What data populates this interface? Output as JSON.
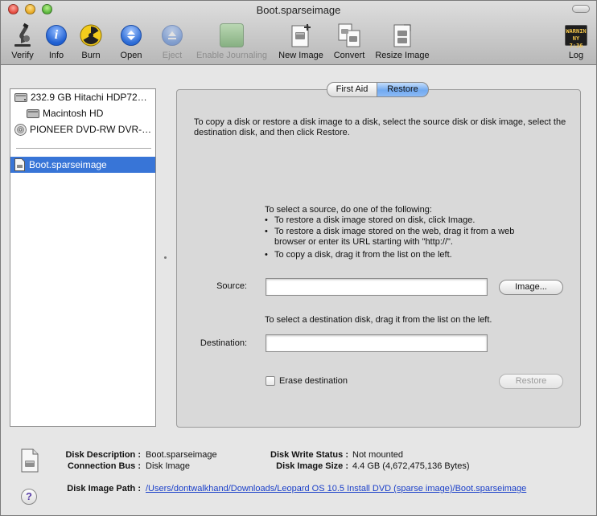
{
  "window": {
    "title": "Boot.sparseimage"
  },
  "toolbar": {
    "verify": "Verify",
    "info": "Info",
    "burn": "Burn",
    "open": "Open",
    "eject": "Eject",
    "enable_journaling": "Enable Journaling",
    "new_image": "New Image",
    "convert": "Convert",
    "resize_image": "Resize Image",
    "log": "Log",
    "log_icon_text_1": "WARNIN",
    "log_icon_text_2": "NY 7:36"
  },
  "sidebar": {
    "items": [
      {
        "label": "232.9 GB Hitachi HDP72…",
        "icon": "hard-drive-icon"
      },
      {
        "label": "Macintosh HD",
        "icon": "volume-icon"
      },
      {
        "label": "PIONEER DVD-RW DVR-…",
        "icon": "optical-drive-icon"
      },
      {
        "label": "Boot.sparseimage",
        "icon": "disk-image-icon",
        "selected": true
      }
    ]
  },
  "tabs": [
    {
      "label": "First Aid",
      "active": false
    },
    {
      "label": "Restore",
      "active": true
    }
  ],
  "restore": {
    "instruction": "To copy a disk or restore a disk image to a disk, select the source disk or disk image, select the destination disk, and then click Restore.",
    "source_heading": "To select a source, do one of the following:",
    "bullets": [
      "To restore a disk image stored on disk, click Image.",
      "To restore a disk image stored on the web, drag it from a web",
      "browser or enter its URL starting with \"http://\".",
      "To copy a disk, drag it from the list on the left."
    ],
    "source_label": "Source:",
    "source_value": "",
    "image_button": "Image...",
    "destination_hint": "To select a destination disk, drag it from the list on the left.",
    "destination_label": "Destination:",
    "destination_value": "",
    "erase_label": "Erase destination",
    "erase_checked": false,
    "restore_button": "Restore"
  },
  "info": {
    "disk_description_label": "Disk Description :",
    "disk_description_value": "Boot.sparseimage",
    "connection_bus_label": "Connection Bus :",
    "connection_bus_value": "Disk Image",
    "disk_write_status_label": "Disk Write Status :",
    "disk_write_status_value": "Not mounted",
    "disk_image_size_label": "Disk Image Size :",
    "disk_image_size_value": "4.4 GB (4,672,475,136 Bytes)",
    "disk_image_path_label": "Disk Image Path :",
    "disk_image_path_value": "/Users/dontwalkhand/Downloads/Leopard OS 10.5 Install DVD (sparse image)/Boot.sparseimage"
  },
  "help": {
    "label": "?"
  },
  "colors": {
    "selection": "#3875d7",
    "active_tab": "#72aaf0",
    "link": "#1a3fc9",
    "close": "#e2473b",
    "minimize": "#e6a721",
    "zoom": "#57b33a"
  }
}
